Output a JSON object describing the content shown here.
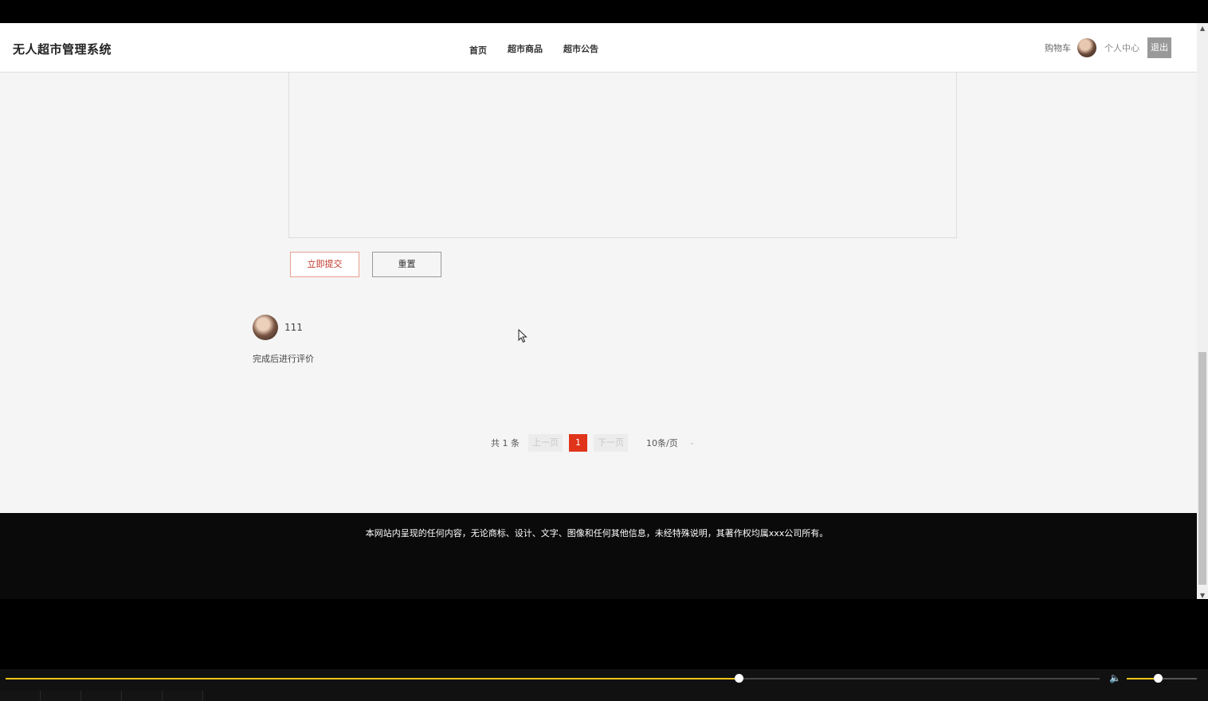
{
  "header": {
    "brand": "无人超市管理系统",
    "nav": [
      "首页",
      "超市商品",
      "超市公告"
    ],
    "cart": "购物车",
    "user_center": "个人中心",
    "logout": "退出"
  },
  "form": {
    "submit": "立即提交",
    "reset": "重置"
  },
  "comment": {
    "user": "111",
    "text": "完成后进行评价"
  },
  "pagination": {
    "total": "共 1 条",
    "prev": "上一页",
    "current": "1",
    "next": "下一页",
    "page_size": "10条/页"
  },
  "footer": {
    "text": "本网站内呈现的任何内容，无论商标、设计、文字、图像和任何其他信息，未经特殊说明，其著作权均属xxx公司所有。"
  },
  "player": {
    "progress_fraction": 0.67,
    "volume_fraction": 0.44,
    "accent_color": "#f5c518"
  },
  "icons": {
    "volume": "volume-icon",
    "dropdown": "chevron-down-icon",
    "scroll_up": "arrow-up-icon",
    "scroll_down": "arrow-down-icon"
  }
}
